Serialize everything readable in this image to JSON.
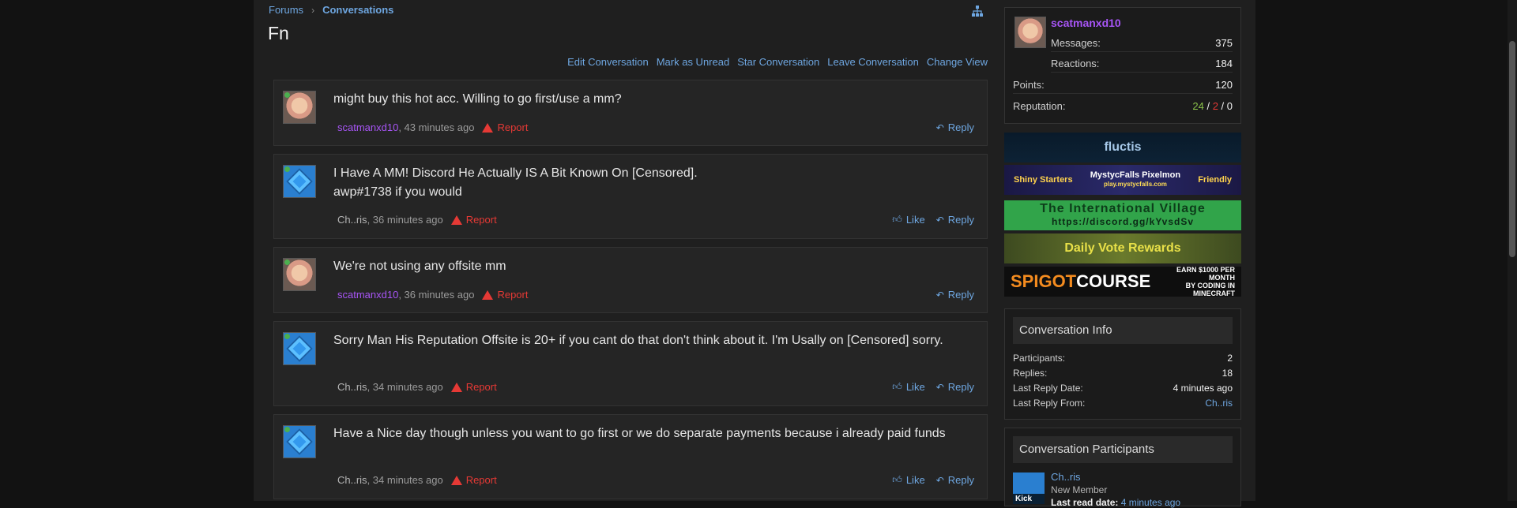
{
  "breadcrumb": {
    "forums": "Forums",
    "conversations": "Conversations"
  },
  "page_title": "Fn",
  "actions": {
    "edit": "Edit Conversation",
    "mark_unread": "Mark as Unread",
    "star": "Star Conversation",
    "leave": "Leave Conversation",
    "change_view": "Change View"
  },
  "messages": [
    {
      "text": "might buy this hot acc. Willing to go first/use a mm?",
      "author": "scatmanxd10",
      "time": ", 43 minutes ago",
      "report": "Report",
      "reply": "Reply"
    },
    {
      "text": "I Have A MM! Discord He Actually IS A Bit Known On [Censored].\nawp#1738 if you would",
      "author": "Ch..ris",
      "time": ", 36 minutes ago",
      "report": "Report",
      "like": "Like",
      "reply": "Reply"
    },
    {
      "text": "We're not using any offsite mm",
      "author": "scatmanxd10",
      "time": ", 36 minutes ago",
      "report": "Report",
      "reply": "Reply"
    },
    {
      "text": "Sorry Man His Reputation Offsite is 20+ if you cant do that don't think about it. I'm Usally on [Censored] sorry.",
      "author": "Ch..ris",
      "time": ", 34 minutes ago",
      "report": "Report",
      "like": "Like",
      "reply": "Reply"
    },
    {
      "text": "Have a Nice day though unless you want to go first or we do separate payments because i already paid funds",
      "author": "Ch..ris",
      "time": ", 34 minutes ago",
      "report": "Report",
      "like": "Like",
      "reply": "Reply"
    }
  ],
  "user": {
    "name": "scatmanxd10",
    "messages_label": "Messages:",
    "messages": "375",
    "reactions_label": "Reactions:",
    "reactions": "184",
    "points_label": "Points:",
    "points": "120",
    "reputation_label": "Reputation:",
    "rep_pos": "24",
    "rep_sep1": " / ",
    "rep_neg": "2",
    "rep_sep2": " / ",
    "rep_neutral": "0"
  },
  "banners": {
    "fluctis": "fluctis",
    "mystyc_left": "Shiny Starters",
    "mystyc_center": "MystycFalls Pixelmon",
    "mystyc_url": "play.mystycfalls.com",
    "mystyc_right": "Friendly",
    "village": "The International Village",
    "village_url": "https://discord.gg/kYvsdSv",
    "vote": "Daily Vote Rewards",
    "spigot_a": "SPIGOT",
    "spigot_b": "COURSE",
    "spigot_earn": "EARN $1000 PER MONTH",
    "spigot_sub": "BY CODING IN MINECRAFT"
  },
  "conversation_info": {
    "heading": "Conversation Info",
    "participants_label": "Participants:",
    "participants": "2",
    "replies_label": "Replies:",
    "replies": "18",
    "last_date_label": "Last Reply Date:",
    "last_date": "4 minutes ago",
    "last_from_label": "Last Reply From:",
    "last_from": "Ch..ris"
  },
  "participants": {
    "heading": "Conversation Participants",
    "kick": "Kick",
    "name": "Ch..ris",
    "title": "New Member",
    "last_read_label": "Last read date:",
    "last_read": "4 minutes ago"
  },
  "colors": {
    "accent": "#6ea6e0",
    "username": "#a855f7",
    "report": "#e53935"
  }
}
